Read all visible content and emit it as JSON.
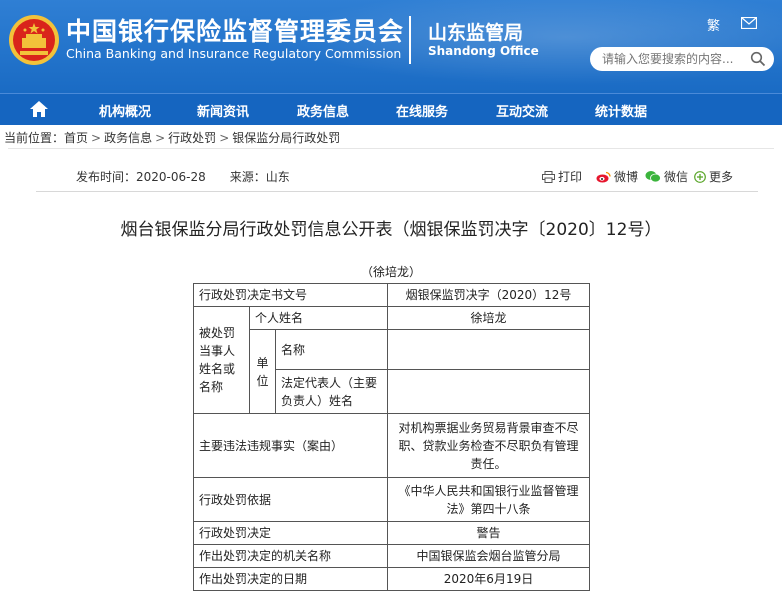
{
  "header": {
    "title_cn": "中国银行保险监督管理委员会",
    "title_en": "China Banking and Insurance Regulatory Commission",
    "office_cn": "山东监管局",
    "office_en": "Shandong Office",
    "top_link": "繁",
    "search_placeholder": "请输入您要搜索的内容..."
  },
  "nav": {
    "items": [
      "机构概况",
      "新闻资讯",
      "政务信息",
      "在线服务",
      "互动交流",
      "统计数据"
    ]
  },
  "breadcrumb": {
    "prefix": "当前位置：",
    "items": [
      "首页",
      "政务信息",
      "行政处罚",
      "银保监分局行政处罚"
    ]
  },
  "meta": {
    "published": "发布时间：2020-06-28",
    "source": "来源：山东"
  },
  "share": {
    "print": "打印",
    "weibo": "微博",
    "wechat": "微信",
    "more": "更多"
  },
  "document": {
    "title": "烟台银保监分局行政处罚信息公开表（烟银保监罚决字〔2020〕12号）",
    "caption": "（徐培龙）",
    "table": {
      "r1_label": "行政处罚决定书文号",
      "r1_value": "烟银保监罚决字（2020）12号",
      "party_label": "被处罚当事人姓名或名称",
      "person_label": "个人姓名",
      "person_value": "徐培龙",
      "unit_label": "单位",
      "unit_name_label": "名称",
      "unit_name_value": "",
      "legal_rep_label": "法定代表人（主要负责人）姓名",
      "legal_rep_value": "",
      "facts_label": "主要违法违规事实（案由）",
      "facts_value": "对机构票据业务贸易背景审查不尽职、贷款业务检查不尽职负有管理责任。",
      "basis_label": "行政处罚依据",
      "basis_value": "《中华人民共和国银行业监督管理法》第四十八条",
      "decision_label": "行政处罚决定",
      "decision_value": "警告",
      "authority_label": "作出处罚决定的机关名称",
      "authority_value": "中国银保监会烟台监管分局",
      "date_label": "作出处罚决定的日期",
      "date_value": "2020年6月19日"
    }
  },
  "colors": {
    "header_blue": "#1a6bc4",
    "nav_blue": "#1565c0",
    "emblem_red": "#d9241b",
    "emblem_gold": "#f2c23a",
    "weibo_red": "#e6162d",
    "wechat_green": "#3bb43c",
    "more_green": "#5aa62a"
  },
  "icons": [
    "national-emblem-icon",
    "mail-icon",
    "search-icon",
    "home-icon",
    "print-icon",
    "weibo-icon",
    "wechat-icon",
    "plus-circle-icon"
  ]
}
